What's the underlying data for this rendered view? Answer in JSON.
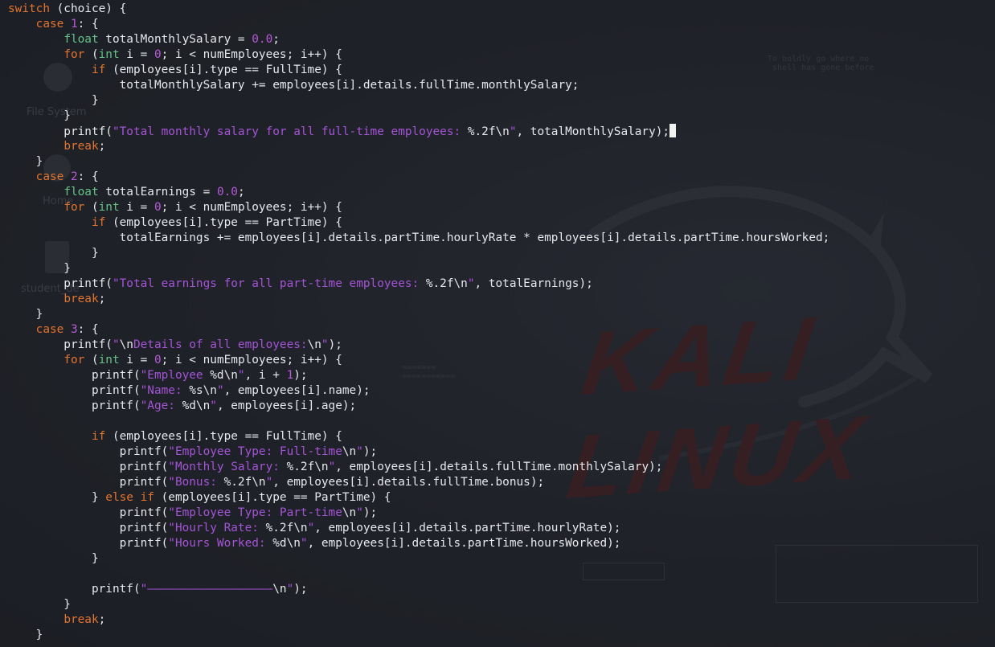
{
  "desktop": {
    "icons": [
      {
        "label": "File System",
        "icon": "drive-icon"
      },
      {
        "label": "Home",
        "icon": "home-folder-icon"
      },
      {
        "label": "student_de",
        "icon": "file-icon"
      }
    ],
    "wallpaper_logo": "KALI LINUX",
    "accent_color": "#3a1f22"
  },
  "terminal": {
    "cursor_visible": true,
    "colors": {
      "keyword": "#e3742f",
      "type": "#66c38a",
      "number": "#b75ad8",
      "string": "#a454d6",
      "text": "#e6e8ec"
    },
    "lines": [
      [
        [
          "kw",
          "switch"
        ],
        [
          "plain",
          " (choice) {"
        ]
      ],
      [
        [
          "plain",
          "    "
        ],
        [
          "kw",
          "case"
        ],
        [
          "plain",
          " "
        ],
        [
          "num",
          "1"
        ],
        [
          "plain",
          ": {"
        ]
      ],
      [
        [
          "plain",
          "        "
        ],
        [
          "ty",
          "float"
        ],
        [
          "plain",
          " totalMonthlySalary = "
        ],
        [
          "num",
          "0.0"
        ],
        [
          "plain",
          ";"
        ]
      ],
      [
        [
          "plain",
          "        "
        ],
        [
          "kw",
          "for"
        ],
        [
          "plain",
          " ("
        ],
        [
          "ty",
          "int"
        ],
        [
          "plain",
          " i = "
        ],
        [
          "num",
          "0"
        ],
        [
          "plain",
          "; i < numEmployees; i++) {"
        ]
      ],
      [
        [
          "plain",
          "            "
        ],
        [
          "kw",
          "if"
        ],
        [
          "plain",
          " (employees[i].type == FullTime) {"
        ]
      ],
      [
        [
          "plain",
          "                totalMonthlySalary += employees[i].details.fullTime.monthlySalary;"
        ]
      ],
      [
        [
          "plain",
          "            }"
        ]
      ],
      [
        [
          "plain",
          "        }"
        ]
      ],
      [
        [
          "plain",
          "        printf("
        ],
        [
          "str",
          "\"Total monthly salary for all full-time employees: "
        ],
        [
          "esc",
          "%.2f\\n"
        ],
        [
          "str",
          "\""
        ],
        [
          "plain",
          ", totalMonthlySalary);"
        ],
        [
          "cursor",
          ""
        ]
      ],
      [
        [
          "plain",
          "        "
        ],
        [
          "kw",
          "break"
        ],
        [
          "plain",
          ";"
        ]
      ],
      [
        [
          "plain",
          "    }"
        ]
      ],
      [
        [
          "plain",
          "    "
        ],
        [
          "kw",
          "case"
        ],
        [
          "plain",
          " "
        ],
        [
          "num",
          "2"
        ],
        [
          "plain",
          ": {"
        ]
      ],
      [
        [
          "plain",
          "        "
        ],
        [
          "ty",
          "float"
        ],
        [
          "plain",
          " totalEarnings = "
        ],
        [
          "num",
          "0.0"
        ],
        [
          "plain",
          ";"
        ]
      ],
      [
        [
          "plain",
          "        "
        ],
        [
          "kw",
          "for"
        ],
        [
          "plain",
          " ("
        ],
        [
          "ty",
          "int"
        ],
        [
          "plain",
          " i = "
        ],
        [
          "num",
          "0"
        ],
        [
          "plain",
          "; i < numEmployees; i++) {"
        ]
      ],
      [
        [
          "plain",
          "            "
        ],
        [
          "kw",
          "if"
        ],
        [
          "plain",
          " (employees[i].type == PartTime) {"
        ]
      ],
      [
        [
          "plain",
          "                totalEarnings += employees[i].details.partTime.hourlyRate * employees[i].details.partTime.hoursWorked;"
        ]
      ],
      [
        [
          "plain",
          "            }"
        ]
      ],
      [
        [
          "plain",
          "        }"
        ]
      ],
      [
        [
          "plain",
          "        printf("
        ],
        [
          "str",
          "\"Total earnings for all part-time employees: "
        ],
        [
          "esc",
          "%.2f\\n"
        ],
        [
          "str",
          "\""
        ],
        [
          "plain",
          ", totalEarnings);"
        ]
      ],
      [
        [
          "plain",
          "        "
        ],
        [
          "kw",
          "break"
        ],
        [
          "plain",
          ";"
        ]
      ],
      [
        [
          "plain",
          "    }"
        ]
      ],
      [
        [
          "plain",
          "    "
        ],
        [
          "kw",
          "case"
        ],
        [
          "plain",
          " "
        ],
        [
          "num",
          "3"
        ],
        [
          "plain",
          ": {"
        ]
      ],
      [
        [
          "plain",
          "        printf("
        ],
        [
          "str",
          "\""
        ],
        [
          "esc",
          "\\n"
        ],
        [
          "str",
          "Details of all employees:"
        ],
        [
          "esc",
          "\\n"
        ],
        [
          "str",
          "\""
        ],
        [
          "plain",
          ");"
        ]
      ],
      [
        [
          "plain",
          "        "
        ],
        [
          "kw",
          "for"
        ],
        [
          "plain",
          " ("
        ],
        [
          "ty",
          "int"
        ],
        [
          "plain",
          " i = "
        ],
        [
          "num",
          "0"
        ],
        [
          "plain",
          "; i < numEmployees; i++) {"
        ]
      ],
      [
        [
          "plain",
          "            printf("
        ],
        [
          "str",
          "\"Employee "
        ],
        [
          "esc",
          "%d\\n"
        ],
        [
          "str",
          "\""
        ],
        [
          "plain",
          ", i + "
        ],
        [
          "num",
          "1"
        ],
        [
          "plain",
          ");"
        ]
      ],
      [
        [
          "plain",
          "            printf("
        ],
        [
          "str",
          "\"Name: "
        ],
        [
          "esc",
          "%s\\n"
        ],
        [
          "str",
          "\""
        ],
        [
          "plain",
          ", employees[i].name);"
        ]
      ],
      [
        [
          "plain",
          "            printf("
        ],
        [
          "str",
          "\"Age: "
        ],
        [
          "esc",
          "%d\\n"
        ],
        [
          "str",
          "\""
        ],
        [
          "plain",
          ", employees[i].age);"
        ]
      ],
      [
        [
          "plain",
          ""
        ]
      ],
      [
        [
          "plain",
          "            "
        ],
        [
          "kw",
          "if"
        ],
        [
          "plain",
          " (employees[i].type == FullTime) {"
        ]
      ],
      [
        [
          "plain",
          "                printf("
        ],
        [
          "str",
          "\"Employee Type: Full-time"
        ],
        [
          "esc",
          "\\n"
        ],
        [
          "str",
          "\""
        ],
        [
          "plain",
          ");"
        ]
      ],
      [
        [
          "plain",
          "                printf("
        ],
        [
          "str",
          "\"Monthly Salary: "
        ],
        [
          "esc",
          "%.2f\\n"
        ],
        [
          "str",
          "\""
        ],
        [
          "plain",
          ", employees[i].details.fullTime.monthlySalary);"
        ]
      ],
      [
        [
          "plain",
          "                printf("
        ],
        [
          "str",
          "\"Bonus: "
        ],
        [
          "esc",
          "%.2f\\n"
        ],
        [
          "str",
          "\""
        ],
        [
          "plain",
          ", employees[i].details.fullTime.bonus);"
        ]
      ],
      [
        [
          "plain",
          "            } "
        ],
        [
          "kw",
          "else"
        ],
        [
          "plain",
          " "
        ],
        [
          "kw",
          "if"
        ],
        [
          "plain",
          " (employees[i].type == PartTime) {"
        ]
      ],
      [
        [
          "plain",
          "                printf("
        ],
        [
          "str",
          "\"Employee Type: Part-time"
        ],
        [
          "esc",
          "\\n"
        ],
        [
          "str",
          "\""
        ],
        [
          "plain",
          ");"
        ]
      ],
      [
        [
          "plain",
          "                printf("
        ],
        [
          "str",
          "\"Hourly Rate: "
        ],
        [
          "esc",
          "%.2f\\n"
        ],
        [
          "str",
          "\""
        ],
        [
          "plain",
          ", employees[i].details.partTime.hourlyRate);"
        ]
      ],
      [
        [
          "plain",
          "                printf("
        ],
        [
          "str",
          "\"Hours Worked: "
        ],
        [
          "esc",
          "%d\\n"
        ],
        [
          "str",
          "\""
        ],
        [
          "plain",
          ", employees[i].details.partTime.hoursWorked);"
        ]
      ],
      [
        [
          "plain",
          "            }"
        ]
      ],
      [
        [
          "plain",
          ""
        ]
      ],
      [
        [
          "plain",
          "            printf("
        ],
        [
          "str",
          "\"――――――――――――――――――"
        ],
        [
          "esc",
          "\\n"
        ],
        [
          "str",
          "\""
        ],
        [
          "plain",
          ");"
        ]
      ],
      [
        [
          "plain",
          "        }"
        ]
      ],
      [
        [
          "plain",
          "        "
        ],
        [
          "kw",
          "break"
        ],
        [
          "plain",
          ";"
        ]
      ],
      [
        [
          "plain",
          "    }"
        ]
      ]
    ]
  }
}
